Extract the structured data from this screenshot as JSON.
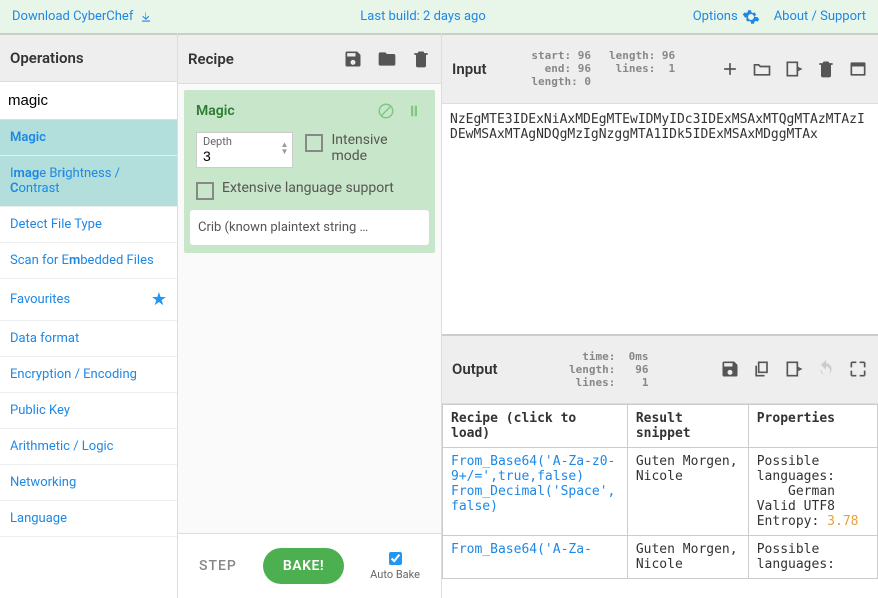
{
  "top": {
    "download": "Download CyberChef",
    "lastbuild": "Last build: 2 days ago",
    "options": "Options",
    "about": "About / Support"
  },
  "ops": {
    "title": "Operations",
    "search": "magic",
    "items": [
      {
        "label_html": "<b>Magic</b>",
        "hl": true
      },
      {
        "label_html": "I<b>mag</b>e Br<b>i</b>ghtness / <b>C</b>ontrast",
        "hl": true
      },
      {
        "label_html": "Detect File Type",
        "hl": false
      },
      {
        "label_html": "Scan for E<b>m</b>bedded Files",
        "hl": false
      },
      {
        "label_html": "Favourites",
        "hl": false,
        "fav": true
      },
      {
        "label_html": "Data format",
        "hl": false
      },
      {
        "label_html": "Encryption / Encoding",
        "hl": false
      },
      {
        "label_html": "Public Key",
        "hl": false
      },
      {
        "label_html": "Arithmetic / Logic",
        "hl": false
      },
      {
        "label_html": "Networking",
        "hl": false
      },
      {
        "label_html": "Language",
        "hl": false
      }
    ]
  },
  "recipe": {
    "title": "Recipe",
    "op_name": "Magic",
    "depth_label": "Depth",
    "depth_value": "3",
    "intensive": "Intensive mode",
    "extensive": "Extensive language support",
    "crib": "Crib (known plaintext string …",
    "step": "STEP",
    "bake": "BAKE!",
    "autobake": "Auto Bake"
  },
  "input": {
    "title": "Input",
    "stats1": "start: 96\n  end: 96\nlength: 0",
    "stats2": "length: 96\n lines:  1",
    "text": "NzEgMTE3IDExNiAxMDEgMTEwIDMyIDc3IDExMSAxMTQgMTAzMTAzIDEwMSAxMTAgNDQgMzIgNzggMTA1IDk5IDExMSAxMDggMTAx"
  },
  "output": {
    "title": "Output",
    "stats": "  time:  0ms\nlength:   96\n lines:    1",
    "cols": [
      "Recipe (click to load)",
      "Result snippet",
      "Properties"
    ],
    "rows": [
      {
        "recipe": "From_Base64('A-Za-z0-9+/=',true,false)\nFrom_Decimal('Space',false)",
        "result": "Guten Morgen, Nicole",
        "props_html": "Possible languages:\n&nbsp;&nbsp;&nbsp;&nbsp;German\nValid UTF8\nEntropy: <span class=\"entropy\">3.78</span>"
      },
      {
        "recipe": "From_Base64('A-Za-",
        "result": "Guten Morgen, Nicole",
        "props_html": "Possible languages:"
      }
    ]
  }
}
